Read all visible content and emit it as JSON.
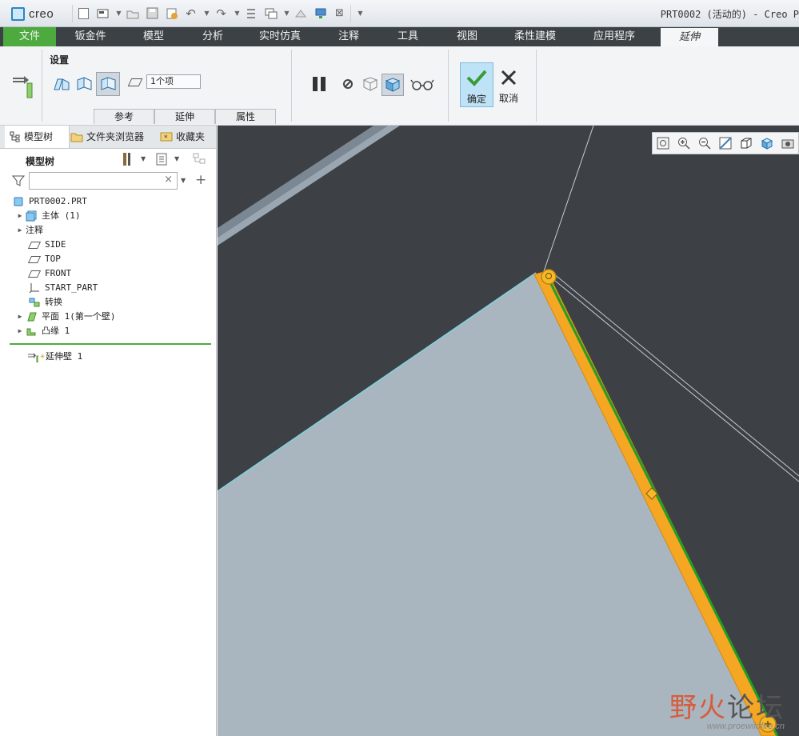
{
  "app": {
    "logo": "creo",
    "window_title": "PRT0002 (活动的) - Creo P"
  },
  "menu": {
    "items": [
      "文件",
      "钣金件",
      "模型",
      "分析",
      "实时仿真",
      "注释",
      "工具",
      "视图",
      "柔性建模",
      "应用程序",
      "延伸"
    ]
  },
  "ribbon": {
    "settings_label": "设置",
    "reference_value": "1个项",
    "subtabs": [
      "参考",
      "延伸",
      "属性"
    ],
    "ok_label": "确定",
    "cancel_label": "取消"
  },
  "left_panel": {
    "tabs": [
      "模型树",
      "文件夹浏览器",
      "收藏夹"
    ],
    "tree_title": "模型树",
    "tree": [
      {
        "label": "PRT0002.PRT"
      },
      {
        "label": "主体 (1)"
      },
      {
        "label": "注释"
      },
      {
        "label": "SIDE"
      },
      {
        "label": "TOP"
      },
      {
        "label": "FRONT"
      },
      {
        "label": "START_PART"
      },
      {
        "label": "转换"
      },
      {
        "label": "平面 1(第一个壁)"
      },
      {
        "label": "凸缘 1"
      },
      {
        "label": "延伸壁 1"
      }
    ]
  },
  "watermark": {
    "title_a": "野火",
    "title_b": "论坛",
    "url": "www.proewildfire.cn"
  },
  "colors": {
    "accent_green": "#4daa3f",
    "menubar_bg": "#3c4146",
    "viewport_bg": "#3d4045",
    "part_face": "#a9b6bf",
    "edge_orange": "#f5a623"
  }
}
